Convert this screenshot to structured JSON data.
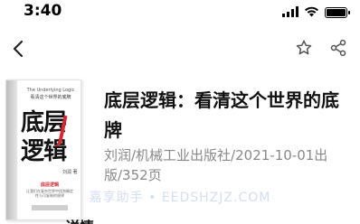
{
  "status_bar": {
    "time": "3:40",
    "icons": [
      "signal-icon",
      "wifi-icon",
      "battery-icon"
    ]
  },
  "nav_bar": {
    "back_icon": "chevron-left-icon",
    "actions": [
      "star-icon",
      "share-icon"
    ]
  },
  "book": {
    "title": "底层逻辑：看清这个世界的底牌",
    "meta": "刘润/机械工业出版社/2021-10-01出版/352页",
    "cover": {
      "title_line_1": "底层",
      "title_line_2": "逻辑",
      "subtitle_en": "The Underlying Logic",
      "subtitle_cn": "看清这个世界的底牌",
      "author": "刘润 著",
      "tag": "底层逻辑",
      "description": "让我们在复杂世界中找到确定性与可复制的规律",
      "accent_color": "#d8262f"
    }
  },
  "watermark": "嘉享助手 • EEDSHZJZ.COM",
  "section_peek": "详情"
}
